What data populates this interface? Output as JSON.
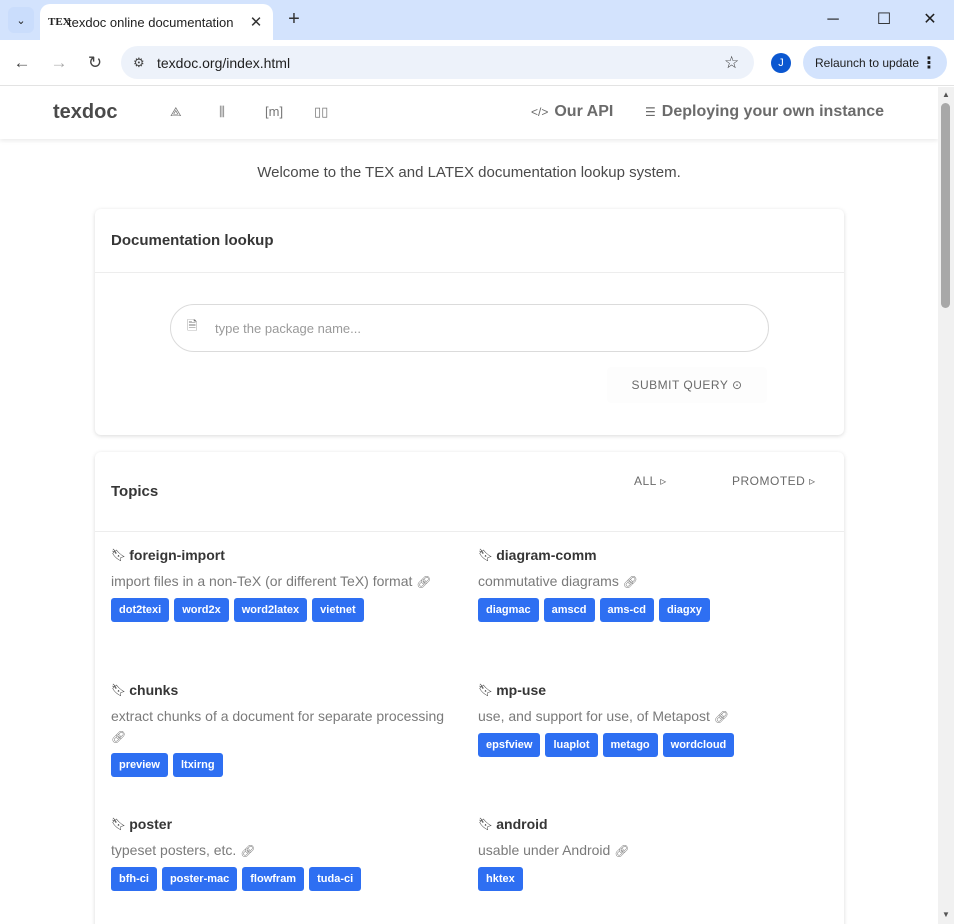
{
  "browser": {
    "tab_title": "texdoc online documentation",
    "tab_favicon": "TEX",
    "url": "texdoc.org/index.html",
    "profile_initial": "J",
    "relaunch_label": "Relaunch to update"
  },
  "nav": {
    "brand": "texdoc",
    "api_label": "Our API",
    "deploy_label": "Deploying your own instance"
  },
  "welcome": "Welcome to the TEX and LATEX documentation lookup system.",
  "lookup": {
    "title": "Documentation lookup",
    "placeholder": "type the package name...",
    "submit_label": "SUBMIT QUERY"
  },
  "topics": {
    "title": "Topics",
    "tab_all": "ALL",
    "tab_promoted": "PROMOTED",
    "items": [
      {
        "name": "foreign-import",
        "desc": "import files in a non-TeX (or different TeX) format",
        "tags": [
          "dot2texi",
          "word2x",
          "word2latex",
          "vietnet"
        ]
      },
      {
        "name": "diagram-comm",
        "desc": "commutative diagrams",
        "tags": [
          "diagmac",
          "amscd",
          "ams-cd",
          "diagxy"
        ]
      },
      {
        "name": "chunks",
        "desc": "extract chunks of a document for separate processing",
        "tags": [
          "preview",
          "ltxirng"
        ]
      },
      {
        "name": "mp-use",
        "desc": "use, and support for use, of Metapost",
        "tags": [
          "epsfview",
          "luaplot",
          "metago",
          "wordcloud"
        ]
      },
      {
        "name": "poster",
        "desc": "typeset posters, etc.",
        "tags": [
          "bfh-ci",
          "poster-mac",
          "flowfram",
          "tuda-ci"
        ]
      },
      {
        "name": "android",
        "desc": "usable under Android",
        "tags": [
          "hktex"
        ]
      }
    ]
  }
}
